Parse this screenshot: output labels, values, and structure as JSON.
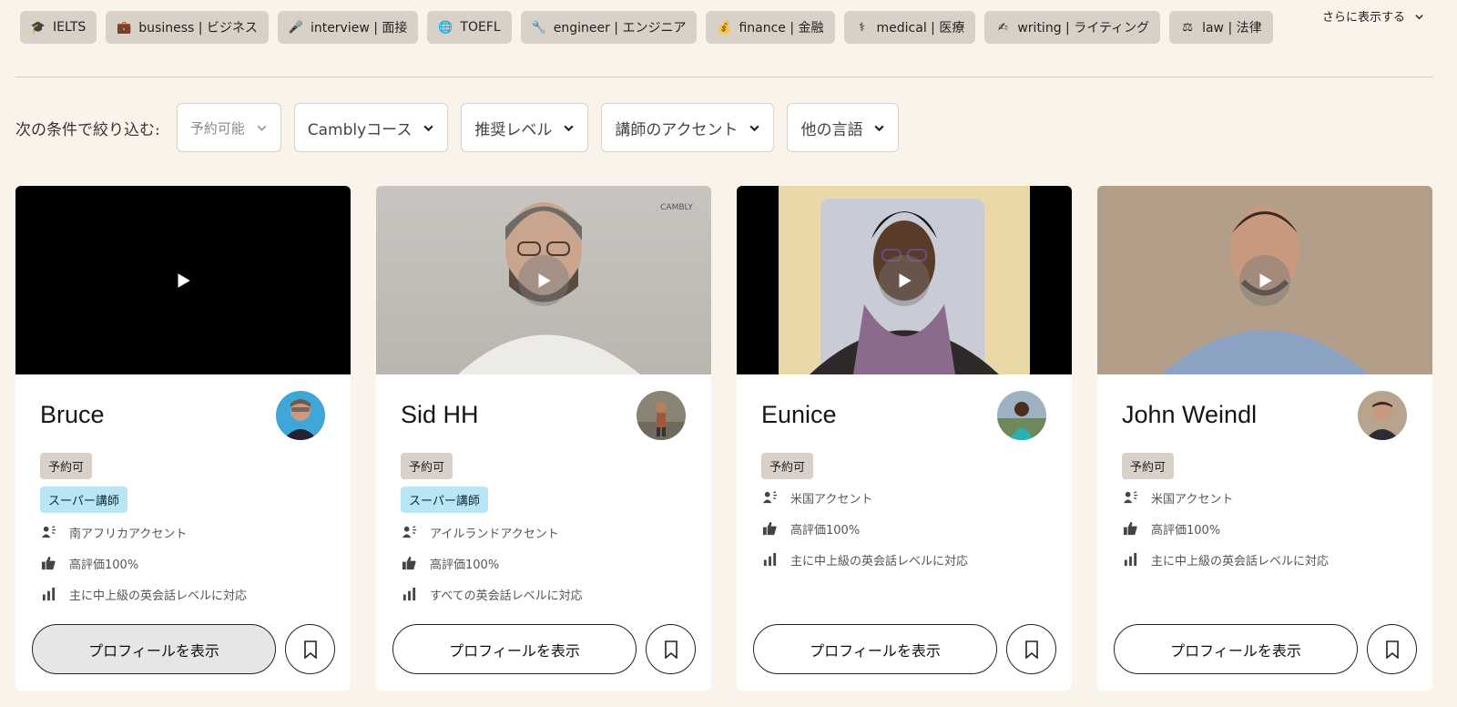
{
  "topic_tags": [
    {
      "label": "IELTS",
      "icon": "🎓"
    },
    {
      "label": "business | ビジネス",
      "icon": "💼"
    },
    {
      "label": "interview | 面接",
      "icon": "🎤"
    },
    {
      "label": "TOEFL",
      "icon": "🌐"
    },
    {
      "label": "engineer | エンジニア",
      "icon": "🔧"
    },
    {
      "label": "finance | 金融",
      "icon": "💰"
    },
    {
      "label": "medical | 医療",
      "icon": "⚕"
    },
    {
      "label": "writing | ライティング",
      "icon": "✍"
    },
    {
      "label": "law | 法律",
      "icon": "⚖"
    }
  ],
  "more_label": "さらに表示する",
  "filters": {
    "label": "次の条件で絞り込む:",
    "buttons": [
      "予約可能",
      "Camblyコース",
      "推奨レベル",
      "講師のアクセント",
      "他の言語"
    ]
  },
  "video_watermark": "CAMBLY",
  "tutors": [
    {
      "name": "Bruce",
      "available": "予約可",
      "super_tutor": "スーパー講師",
      "accent": "南アフリカアクセント",
      "rating": "高評価100%",
      "level": "主に中上級の英会話レベルに対応",
      "profile_button": "プロフィールを表示"
    },
    {
      "name": "Sid HH",
      "available": "予約可",
      "super_tutor": "スーパー講師",
      "accent": "アイルランドアクセント",
      "rating": "高評価100%",
      "level": "すべての英会話レベルに対応",
      "profile_button": "プロフィールを表示"
    },
    {
      "name": "Eunice",
      "available": "予約可",
      "accent": "米国アクセント",
      "rating": "高評価100%",
      "level": "主に中上級の英会話レベルに対応",
      "profile_button": "プロフィールを表示"
    },
    {
      "name": "John Weindl",
      "available": "予約可",
      "accent": "米国アクセント",
      "rating": "高評価100%",
      "level": "主に中上級の英会話レベルに対応",
      "profile_button": "プロフィールを表示"
    }
  ]
}
